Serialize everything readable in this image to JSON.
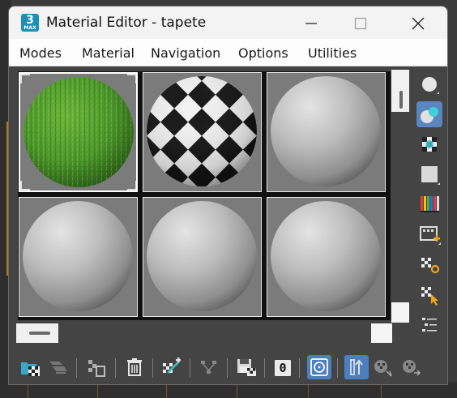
{
  "window": {
    "title": "Material Editor - tapete",
    "app_icon_text": "3",
    "app_icon_subtext": "MAX",
    "minimize_icon": "minimize-icon",
    "maximize_icon": "maximize-icon",
    "close_icon": "close-icon"
  },
  "menu": {
    "items": [
      {
        "label": "Modes"
      },
      {
        "label": "Material"
      },
      {
        "label": "Navigation"
      },
      {
        "label": "Options"
      },
      {
        "label": "Utilities"
      }
    ]
  },
  "sample_slots": [
    {
      "material": "grass",
      "selected": true
    },
    {
      "material": "checker",
      "selected": false
    },
    {
      "material": "default-gray",
      "selected": false
    },
    {
      "material": "default-gray",
      "selected": false
    },
    {
      "material": "default-gray",
      "selected": false
    },
    {
      "material": "default-gray",
      "selected": false
    }
  ],
  "side_toolbar": [
    {
      "icon": "sample-type-sphere-icon",
      "active": false
    },
    {
      "icon": "backlight-icon",
      "active": true
    },
    {
      "icon": "background-checker-icon",
      "active": false
    },
    {
      "icon": "sample-uv-tiling-icon",
      "active": false
    },
    {
      "icon": "video-color-check-icon",
      "active": false
    },
    {
      "icon": "make-preview-icon",
      "active": false
    },
    {
      "icon": "material-editor-options-icon",
      "active": false
    },
    {
      "icon": "select-by-material-icon",
      "active": false
    },
    {
      "icon": "material-map-navigator-icon",
      "active": false
    }
  ],
  "bottom_toolbar": {
    "material_id_channel": "0",
    "tools": [
      "get-material-icon",
      "put-to-scene-icon",
      "assign-to-selection-icon",
      "reset-map-icon",
      "make-unique-icon",
      "put-to-library-icon",
      "material-id-channel-icon",
      "show-shaded-in-viewport-icon",
      "show-end-result-icon",
      "go-to-parent-icon",
      "go-forward-to-sibling-icon"
    ]
  },
  "colors": {
    "accent_active": "#4c7fbf",
    "window_bg": "#444444",
    "title_bg": "#f3f3f3",
    "grass": "#4f9a2c",
    "slot_bg": "#7b7b7b"
  }
}
